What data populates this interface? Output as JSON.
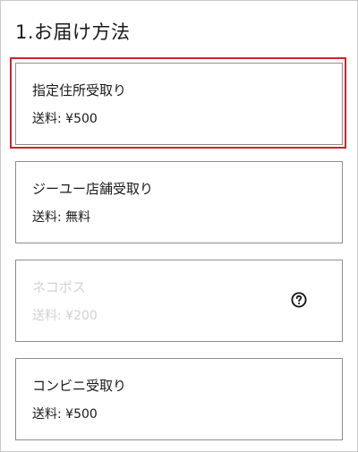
{
  "section": {
    "title": "1.お届け方法"
  },
  "options": [
    {
      "name": "指定住所受取り",
      "fee": "送料: ¥500",
      "selected": true,
      "enabled": true
    },
    {
      "name": "ジーユー店舗受取り",
      "fee": "送料: 無料",
      "selected": false,
      "enabled": true
    },
    {
      "name": "ネコポス",
      "fee": "送料: ¥200",
      "selected": false,
      "enabled": false
    },
    {
      "name": "コンビニ受取り",
      "fee": "送料: ¥500",
      "selected": false,
      "enabled": true
    }
  ],
  "icons": {
    "help": "question-circle-icon"
  },
  "colors": {
    "selected_border": "#d0242b",
    "card_border": "#8e8e8e",
    "disabled_text": "#d2d2d2",
    "text": "#1a1a1a"
  }
}
